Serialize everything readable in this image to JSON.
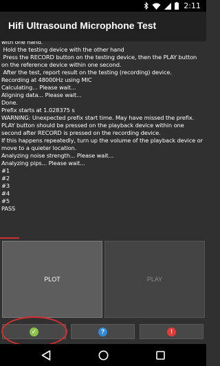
{
  "status_bar": {
    "time": "2:11",
    "icons": [
      "bluetooth-icon",
      "wifi-icon",
      "signal-icon",
      "battery-icon"
    ]
  },
  "app": {
    "title": "Hifi Ultrasound Microphone Test"
  },
  "log": {
    "lines": [
      "with one hand.",
      " Hold the testing device with the other hand",
      " Press the RECORD button on the testing device, then the PLAY button on the reference device within one second.",
      " After the test, report result on the testing (recording) device.",
      "Recording at 48000Hz using MIC",
      "Calculating... Please wait...",
      "Aligning data... Please wait...",
      "Done.",
      "Prefix starts at 1.028375 s",
      "WARNING: Unexpected prefix start time. May have missed the prefix.",
      "PLAY button should be pressed on the playback device within one second after RECORD is pressed on the recording device.",
      "If this happens repeatedly, turn up the volume of the playback device or move to a quieter location.",
      "Analyzing noise strength... Please wait...",
      "Analyzing pips... Please wait...",
      "#1",
      "#2",
      "#3",
      "#4",
      "#5",
      "PASS"
    ]
  },
  "buttons": {
    "plot_label": "PLOT",
    "play_label": "PLAY",
    "pass_icon": "check-icon",
    "info_icon": "question-icon",
    "fail_icon": "exclamation-icon",
    "pass_glyph": "✓",
    "info_glyph": "?",
    "fail_glyph": "!"
  },
  "colors": {
    "background": "#303030",
    "action_bar": "#212121",
    "pass_green": "#8bc34a",
    "info_blue": "#2f8ad8",
    "fail_red": "#e53935",
    "annotation_red": "#d32f2f"
  },
  "nav_bar": {
    "icons": [
      "back-icon",
      "home-icon",
      "recent-apps-icon"
    ]
  }
}
